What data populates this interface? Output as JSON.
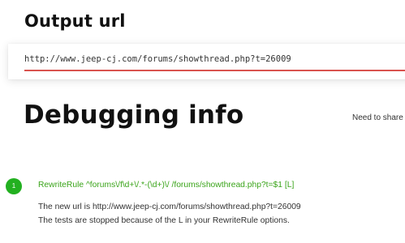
{
  "output": {
    "heading": "Output url",
    "url": "http://www.jeep-cj.com/forums/showthread.php?t=26009"
  },
  "debug": {
    "heading": "Debugging info",
    "share_text": "Need to share",
    "steps": [
      {
        "number": "1",
        "rule": "RewriteRule ^forums\\/f\\d+\\/.*-(\\d+)\\/ /forums/showthread.php?t=$1 [L]",
        "lines": [
          "The new url is http://www.jeep-cj.com/forums/showthread.php?t=26009",
          "The tests are stopped because of the L in your RewriteRule options."
        ]
      }
    ]
  },
  "colors": {
    "accent_underline": "#d9534f",
    "success_green": "#22b020",
    "rule_green": "#3aa41a"
  }
}
